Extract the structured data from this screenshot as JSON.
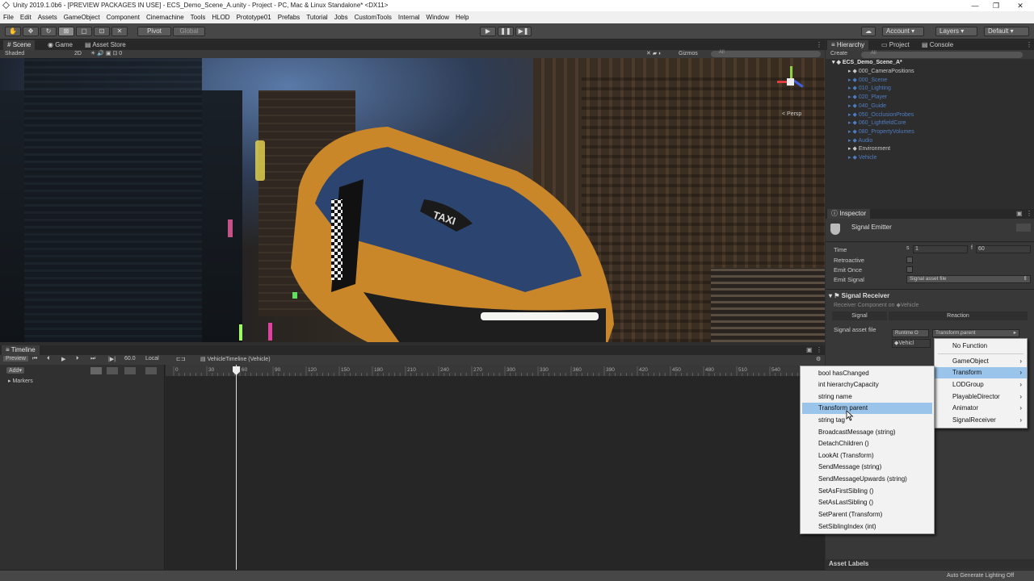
{
  "window": {
    "title": "Unity 2019.1.0b6 - [PREVIEW PACKAGES IN USE] - ECS_Demo_Scene_A.unity - Project - PC, Mac & Linux Standalone* <DX11>",
    "minimize": "—",
    "maximize": "❐",
    "close": "✕"
  },
  "menu": [
    "File",
    "Edit",
    "Assets",
    "GameObject",
    "Component",
    "Cinemachine",
    "Tools",
    "HLOD",
    "Prototype01",
    "Prefabs",
    "Tutorial",
    "Jobs",
    "CustomTools",
    "Internal",
    "Window",
    "Help"
  ],
  "toolbar": {
    "pivot": "Pivot",
    "global": "Global",
    "play_icon": "play-icon",
    "pause_icon": "pause-icon",
    "step_icon": "step-icon",
    "account": "Account",
    "layers": "Layers",
    "layout": "Default"
  },
  "scene_tabs": {
    "scene": "Scene",
    "game": "Game",
    "asset_store": "Asset Store"
  },
  "scene_bar": {
    "shading": "Shaded",
    "mode_2d": "2D",
    "gizmos": "Gizmos",
    "search_placeholder": "All"
  },
  "scene_view": {
    "persp": "< Persp",
    "taxi_label": "TAXI"
  },
  "hierarchy": {
    "tabs": {
      "hierarchy": "Hierarchy",
      "project": "Project",
      "console": "Console"
    },
    "create": "Create",
    "search_placeholder": "All",
    "root": "ECS_Demo_Scene_A*",
    "items": [
      {
        "label": "000_CameraPositions",
        "muted": false
      },
      {
        "label": "000_Scene",
        "muted": true
      },
      {
        "label": "010_Lighting",
        "muted": true
      },
      {
        "label": "020_Player",
        "muted": true
      },
      {
        "label": "040_Guide",
        "muted": true
      },
      {
        "label": "050_OcclusionProbes",
        "muted": true
      },
      {
        "label": "060_LightfieldCore",
        "muted": true
      },
      {
        "label": "080_PropertyVolumes",
        "muted": true
      },
      {
        "label": "Audio",
        "muted": true
      },
      {
        "label": "Environment",
        "muted": false
      },
      {
        "label": "Vehicle",
        "muted": true
      }
    ]
  },
  "inspector": {
    "tab": "Inspector",
    "component": "Signal Emitter",
    "time_label": "Time",
    "time_s_prefix": "s",
    "time_s": "1",
    "time_f_prefix": "f",
    "time_f": "60",
    "retroactive": "Retroactive",
    "emit_once": "Emit Once",
    "emit_signal_label": "Emit Signal",
    "emit_signal_value": "Signal asset file",
    "receiver_title": "Signal Receiver",
    "receiver_sub": "Receiver Component on",
    "receiver_target": "Vehicle",
    "col_signal": "Signal",
    "col_reaction": "Reaction",
    "signal_asset_label": "Signal asset file",
    "runtime_label": "Runtime O ",
    "function_value": "Transform.parent",
    "object_value": "Vehicl",
    "asset_labels": "Asset Labels"
  },
  "timeline": {
    "tab": "Timeline",
    "preview": "Preview",
    "frame": "60.0",
    "local": "Local",
    "asset_name": "VehicleTimeline (Vehicle)",
    "add": "Add",
    "markers": "Markers",
    "ruler": [
      "0",
      "30",
      "60",
      "90",
      "120",
      "150",
      "180",
      "210",
      "240",
      "270",
      "300",
      "330",
      "360",
      "390",
      "420",
      "450",
      "480",
      "510",
      "540"
    ],
    "playhead_frame": 60
  },
  "context_menu_right": {
    "items": [
      {
        "label": "No Function",
        "arrow": false,
        "selected": false
      },
      {
        "label": "GameObject",
        "arrow": true,
        "selected": false
      },
      {
        "label": "Transform",
        "arrow": true,
        "selected": true
      },
      {
        "label": "LODGroup",
        "arrow": true,
        "selected": false
      },
      {
        "label": "PlayableDirector",
        "arrow": true,
        "selected": false
      },
      {
        "label": "Animator",
        "arrow": true,
        "selected": false
      },
      {
        "label": "SignalReceiver",
        "arrow": true,
        "selected": false
      }
    ]
  },
  "context_menu_left": {
    "items": [
      "bool hasChanged",
      "int hierarchyCapacity",
      "string name",
      "Transform parent",
      "string tag",
      "BroadcastMessage (string)",
      "DetachChildren ()",
      "LookAt (Transform)",
      "SendMessage (string)",
      "SendMessageUpwards (string)",
      "SetAsFirstSibling ()",
      "SetAsLastSibling ()",
      "SetParent (Transform)",
      "SetSiblingIndex (int)"
    ],
    "selected_index": 3
  },
  "status": {
    "auto_lighting": "Auto Generate Lighting Off"
  },
  "colors": {
    "accent_blue": "#4f7dc0",
    "menu_highlight": "#9bc4ea",
    "taxi_yellow": "#d89a2c"
  }
}
